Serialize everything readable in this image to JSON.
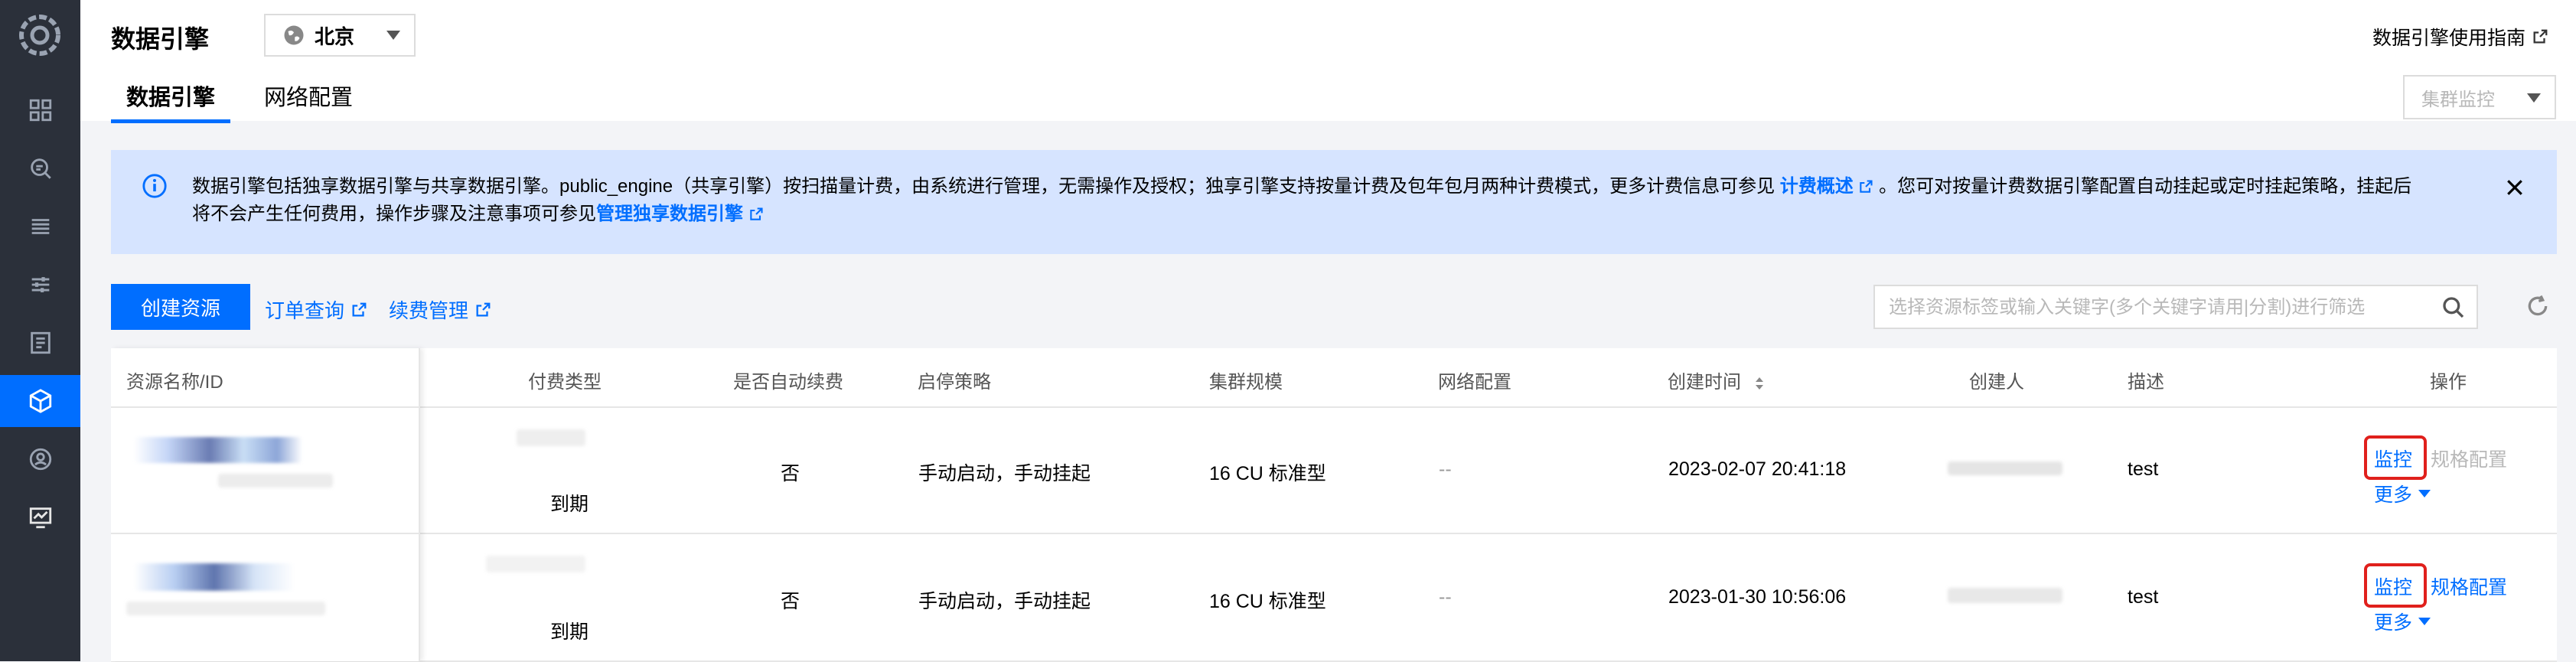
{
  "header": {
    "title": "数据引擎",
    "region": "北京",
    "guide_link": "数据引擎使用指南",
    "tabs": [
      {
        "label": "数据引擎",
        "active": true
      },
      {
        "label": "网络配置",
        "active": false
      }
    ],
    "cluster_monitor_placeholder": "集群监控"
  },
  "sidebar": {
    "items": [
      {
        "icon": "dashboard-icon"
      },
      {
        "icon": "query-icon"
      },
      {
        "icon": "list-icon"
      },
      {
        "icon": "settings-sliders-icon"
      },
      {
        "icon": "document-icon"
      },
      {
        "icon": "cube-icon",
        "active": true
      },
      {
        "icon": "user-badge-icon"
      },
      {
        "icon": "monitor-icon"
      }
    ]
  },
  "notice": {
    "part1": "数据引擎包括独享数据引擎与共享数据引擎。public_engine（共享引擎）按扫描量计费，由系统进行管理，无需操作及授权；独享引擎支持按量计费及包年包月两种计费模式，更多计费信息可参见 ",
    "link1": "计费概述",
    "part2": " 。您可对按量计费数据引擎配置自动挂起或定时挂起策略，挂起后",
    "part3": "将不会产生任何费用，操作步骤及注意事项可参见",
    "link2": "管理独享数据引擎"
  },
  "toolbar": {
    "create_button": "创建资源",
    "order_link": "订单查询",
    "renew_link": "续费管理",
    "search_placeholder": "选择资源标签或输入关键字(多个关键字请用|分割)进行筛选"
  },
  "table": {
    "columns": {
      "name": "资源名称/ID",
      "pay_type": "付费类型",
      "auto_renew": "是否自动续费",
      "policy": "启停策略",
      "scale": "集群规模",
      "network": "网络配置",
      "created": "创建时间",
      "creator": "创建人",
      "desc": "描述",
      "ops": "操作"
    },
    "rows": [
      {
        "pay_type_sub": "到期",
        "auto_renew": "否",
        "policy": "手动启动，手动挂起",
        "scale": "16 CU 标准型",
        "network": "--",
        "created": "2023-02-07 20:41:18",
        "desc": "test",
        "op_monitor": "监控",
        "op_spec": "规格配置",
        "op_more": "更多",
        "spec_enabled": false
      },
      {
        "pay_type_sub": "到期",
        "auto_renew": "否",
        "policy": "手动启动，手动挂起",
        "scale": "16 CU 标准型",
        "network": "--",
        "created": "2023-01-30 10:56:06",
        "desc": "test",
        "op_monitor": "监控",
        "op_spec": "规格配置",
        "op_more": "更多",
        "spec_enabled": true
      }
    ]
  },
  "colors": {
    "accent": "#006eff",
    "sidebar_bg": "#2b303a",
    "notice_bg": "#d6e4ff",
    "highlight": "#e0201c"
  }
}
